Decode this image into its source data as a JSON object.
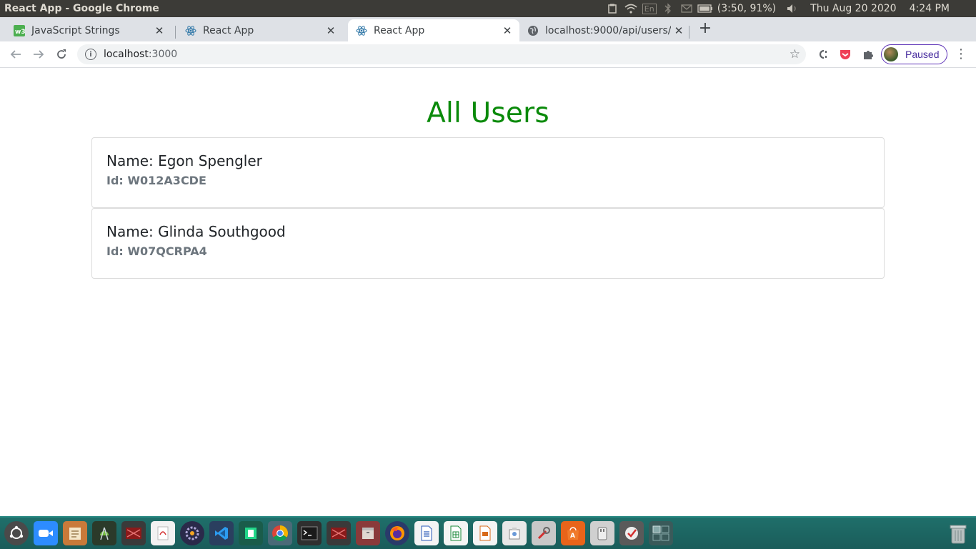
{
  "os": {
    "window_title": "React App - Google Chrome",
    "battery": "(3:50, 91%)",
    "datetime": "Thu Aug 20 2020",
    "clock": "4:24 PM",
    "keyboard": "En"
  },
  "browser": {
    "tabs": [
      {
        "label": "JavaScript Strings",
        "favicon": "w3schools-icon",
        "active": false
      },
      {
        "label": "React App",
        "favicon": "react-icon",
        "active": false
      },
      {
        "label": "React App",
        "favicon": "react-icon",
        "active": true
      },
      {
        "label": "localhost:9000/api/users/",
        "favicon": "globe-icon",
        "active": false
      }
    ],
    "url_host": "localhost",
    "url_port": ":3000",
    "profile_label": "Paused"
  },
  "page": {
    "title": "All Users",
    "users": [
      {
        "name": "Name: Egon Spengler",
        "id": "Id: W012A3CDE"
      },
      {
        "name": "Name: Glinda Southgood",
        "id": "Id: W07QCRPA4"
      }
    ]
  },
  "colors": {
    "title_green": "#0a8a0a",
    "profile_purple": "#5f35b8"
  }
}
